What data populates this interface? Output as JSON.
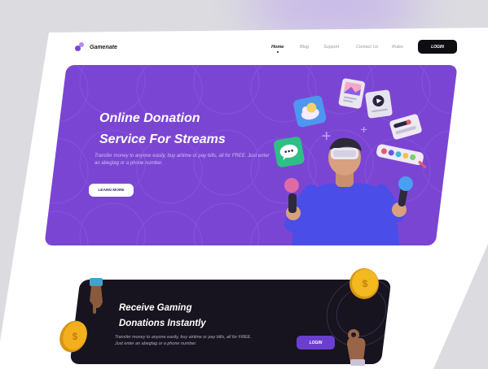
{
  "brand": {
    "name": "Gamenate"
  },
  "nav": {
    "items": [
      {
        "label": "Home"
      },
      {
        "label": "Blog"
      },
      {
        "label": "Support"
      },
      {
        "label": "Contact Us"
      },
      {
        "label": "Rules"
      }
    ],
    "login_label": "LOGIN"
  },
  "hero": {
    "title_line1": "Online Donation",
    "title_line2": "Service For Streams",
    "subtitle": "Transfer money to anyone easily, buy airtime or pay bills, all for FREE. Just enter an abegtag or a phone number.",
    "cta_label": "LEARN MORE"
  },
  "card": {
    "title_line1": "Receive Gaming",
    "title_line2": "Donations Instantly",
    "subtitle": "Transfer money to anyone easily, buy airtime or pay bills, all for FREE. Just enter an abegtag or a phone number.",
    "login_label": "LOGIN"
  },
  "colors": {
    "accent": "#7b45d3",
    "dark": "#17141f",
    "button_dark": "#0d0d12",
    "card_button": "#6a3fd0",
    "coin": "#f2b01e"
  },
  "icons": [
    "logo-icon",
    "photo-card-icon",
    "play-card-icon",
    "chat-bubble-icon",
    "cloud-icon",
    "toggle-card-icon",
    "palette-icon",
    "coin-icon",
    "hand-icon"
  ]
}
